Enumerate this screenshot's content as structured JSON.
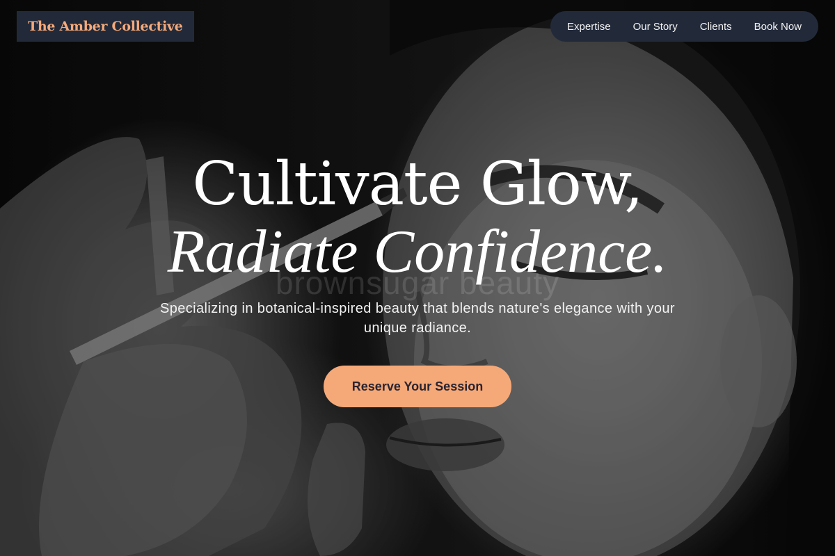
{
  "brand": {
    "name": "The Amber Collective",
    "accent_color": "#f5a97a",
    "bar_color": "#222a3a"
  },
  "nav": {
    "items": [
      {
        "label": "Expertise"
      },
      {
        "label": "Our Story"
      },
      {
        "label": "Clients"
      },
      {
        "label": "Book Now"
      }
    ]
  },
  "hero": {
    "headline_line1": "Cultivate Glow,",
    "headline_line2": "Radiate Confidence.",
    "watermark": "brownsugar beauty",
    "subtitle": "Specializing in botanical-inspired beauty that blends nature's elegance with your unique radiance.",
    "cta_label": "Reserve Your Session",
    "cta_color": "#f6a978",
    "image": "black-and-white photo of makeup artist applying eyeliner to a woman"
  }
}
